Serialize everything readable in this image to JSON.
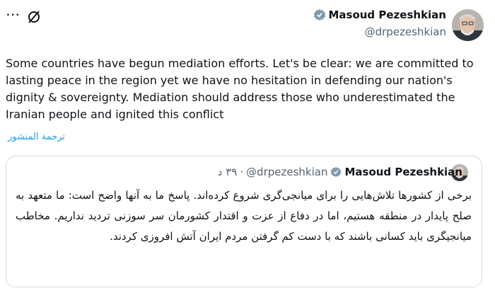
{
  "author": {
    "name": "Masoud Pezeshkian",
    "handle": "@drpezeshkian",
    "verified_badge_color": "#829aab"
  },
  "post": {
    "text": "Some countries have begun mediation efforts. Let's be clear: we are committed to lasting peace in the region yet we have no hesitation in defending our nation's dignity & sovereignty. Mediation should address those who underestimated the Iranian people and ignited this conflict",
    "translate_label": "ترجمة المنشور"
  },
  "quoted_post": {
    "name": "Masoud Pezeshkian",
    "handle": "@drpezeshkian",
    "time": "۳۹ د",
    "separator": "·",
    "text": "برخی از کشورها تلاش‌هایی را برای میانجی‌گری شروع کرده‌اند. پاسخ ما به آنها واضح است: ما متعهد به صلح پایدار در منطقه هستیم، اما در دفاع از عزت و اقتدار کشورمان سر سوزنی تردید نداریم. مخاطب میانجیگری باید کسانی باشند که با دست کم گرفتن مردم ایران آتش افروزی کردند."
  },
  "icons": {
    "more": "more-icon",
    "grok": "grok-icon",
    "verified": "verified-badge-icon"
  }
}
